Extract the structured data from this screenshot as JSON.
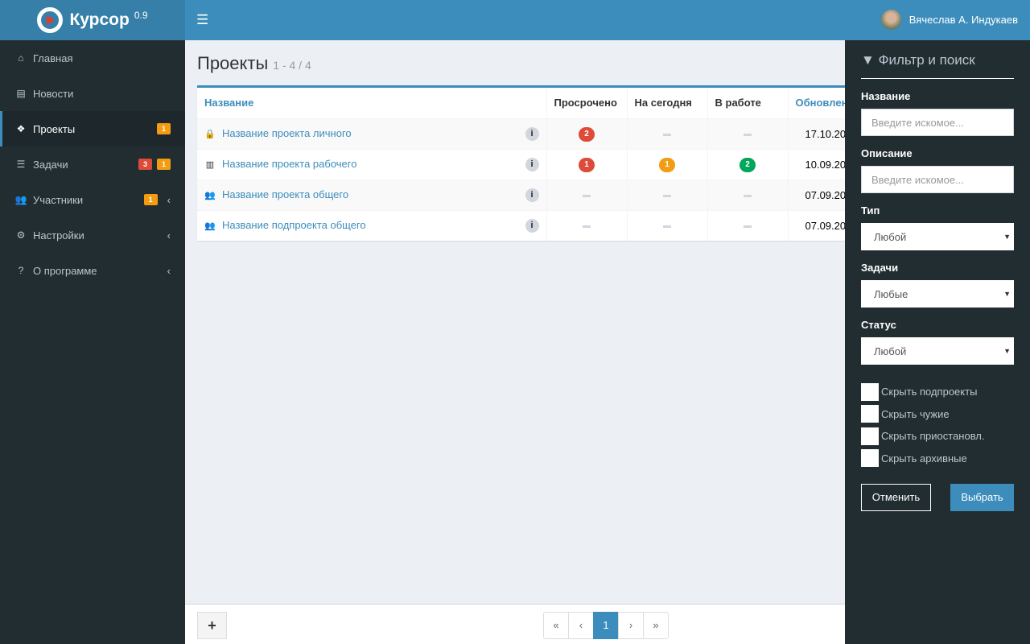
{
  "header": {
    "app_name": "Курсор",
    "version": "0.9",
    "user": "Вячеслав А. Индукаев"
  },
  "sidebar": {
    "items": [
      {
        "label": "Главная",
        "icon": "home-icon",
        "glyph": "⌂"
      },
      {
        "label": "Новости",
        "icon": "newspaper-icon",
        "glyph": "▤"
      },
      {
        "label": "Проекты",
        "icon": "cubes-icon",
        "glyph": "❖",
        "badges": [
          "1"
        ]
      },
      {
        "label": "Задачи",
        "icon": "tasks-icon",
        "glyph": "☰",
        "badges": [
          "3",
          "1"
        ]
      },
      {
        "label": "Участники",
        "icon": "users-icon",
        "glyph": "👥",
        "badges": [
          "1"
        ]
      },
      {
        "label": "Настройки",
        "icon": "cogs-icon",
        "glyph": "⚙"
      },
      {
        "label": "О программе",
        "icon": "question-circle-icon",
        "glyph": "?"
      }
    ]
  },
  "main": {
    "title": "Проекты",
    "range": "1 - 4 / 4",
    "columns": [
      "Название",
      "Просрочено",
      "На сегодня",
      "В работе",
      "Обновлен"
    ],
    "rows": [
      {
        "name": "Название проекта личного",
        "icon": "lock-icon",
        "glyph": "🔒",
        "overdue": "2",
        "today": "",
        "inwork": "",
        "updated": "17.10.20"
      },
      {
        "name": "Название проекта рабочего",
        "icon": "building-icon",
        "glyph": "▥",
        "overdue": "1",
        "today": "1",
        "inwork": "2",
        "updated": "10.09.20"
      },
      {
        "name": "Название проекта общего",
        "icon": "users-icon",
        "glyph": "👥",
        "overdue": "",
        "today": "",
        "inwork": "",
        "updated": "07.09.20"
      },
      {
        "name": "Название подпроекта общего",
        "icon": "users-icon",
        "glyph": "👥",
        "overdue": "",
        "today": "",
        "inwork": "",
        "updated": "07.09.20"
      }
    ]
  },
  "colors": {
    "overdue": "#dd4b39",
    "today": "#f39c12",
    "inwork": "#00a65a",
    "accent": "#3c8dbc"
  },
  "footer": {
    "add": "+",
    "pager": [
      "«",
      "‹",
      "1",
      "›",
      "»"
    ]
  },
  "filter": {
    "title": "Фильтр и поиск",
    "name_label": "Название",
    "name_placeholder": "Введите искомое...",
    "desc_label": "Описание",
    "desc_placeholder": "Введите искомое...",
    "type_label": "Тип",
    "type_value": "Любой",
    "tasks_label": "Задачи",
    "tasks_value": "Любые",
    "status_label": "Статус",
    "status_value": "Любой",
    "checks": [
      "Скрыть подпроекты",
      "Скрыть чужие",
      "Скрыть приостановл.",
      "Скрыть архивные"
    ],
    "cancel": "Отменить",
    "apply": "Выбрать"
  }
}
